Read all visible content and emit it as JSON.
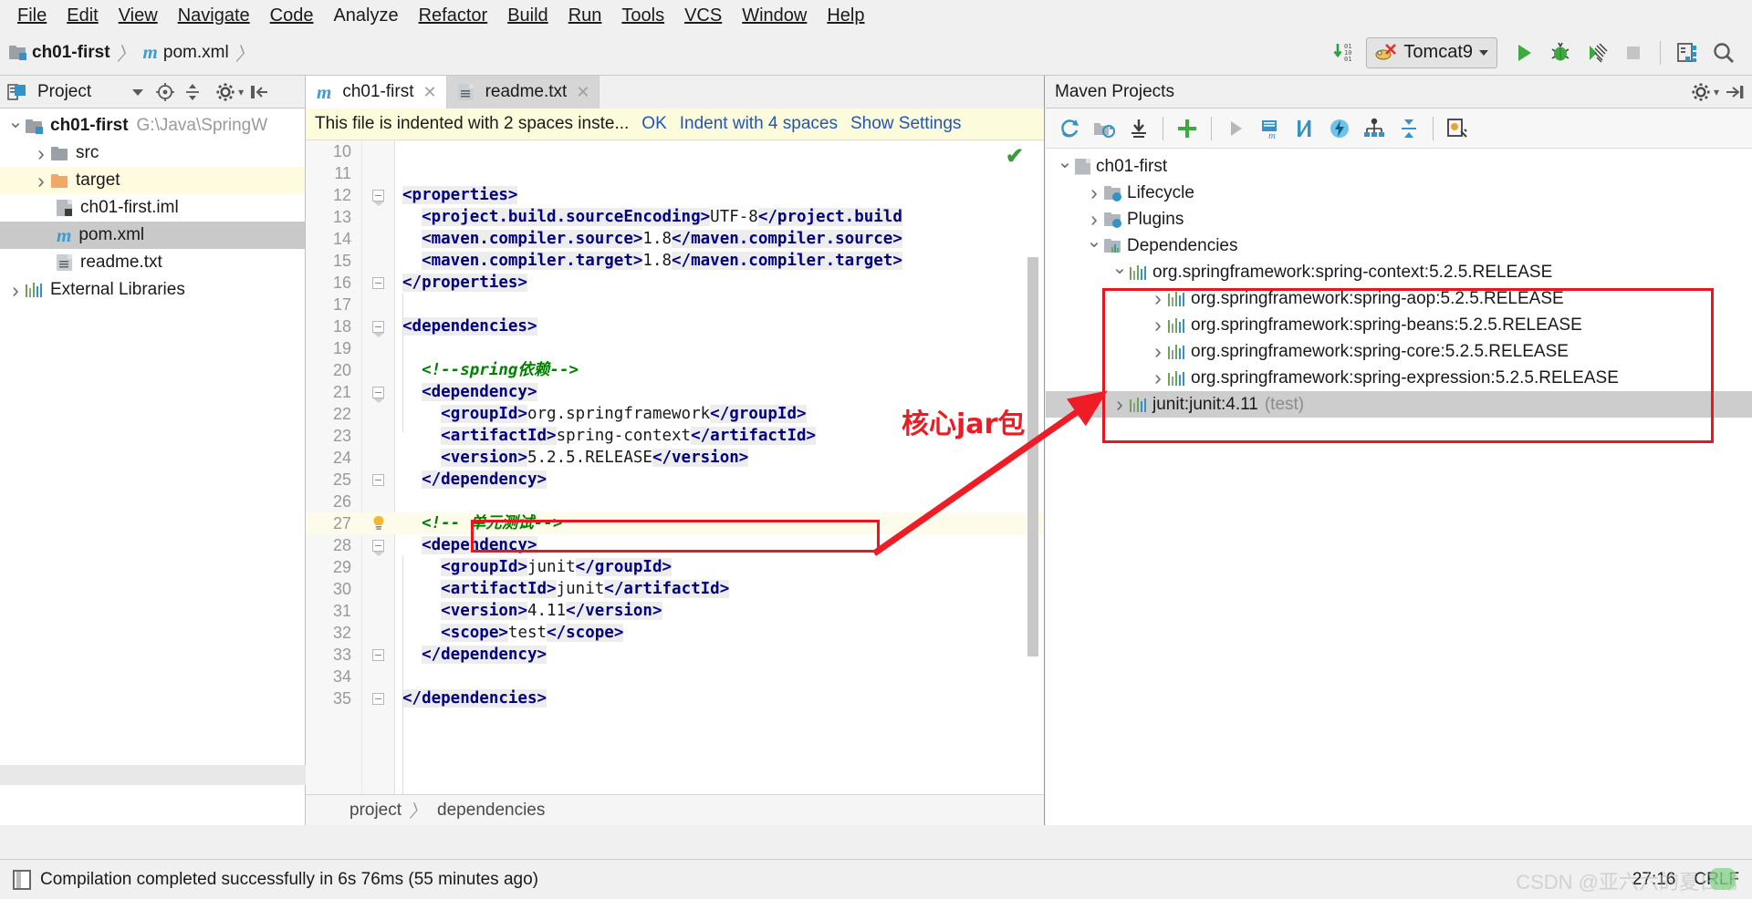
{
  "menubar": {
    "items": [
      {
        "label": "File"
      },
      {
        "label": "Edit"
      },
      {
        "label": "View"
      },
      {
        "label": "Navigate"
      },
      {
        "label": "Code"
      },
      {
        "label": "Analyze"
      },
      {
        "label": "Refactor"
      },
      {
        "label": "Build"
      },
      {
        "label": "Run"
      },
      {
        "label": "Tools"
      },
      {
        "label": "VCS"
      },
      {
        "label": "Window"
      },
      {
        "label": "Help"
      }
    ]
  },
  "navbar": {
    "breadcrumbs": [
      {
        "label": "ch01-first",
        "icon": "folder-icon"
      },
      {
        "label": "pom.xml",
        "icon": "maven-m-icon"
      }
    ],
    "run_config": {
      "label": "Tomcat9",
      "icon": "tomcat-icon"
    },
    "icons": [
      "download-updates-icon",
      "run-icon",
      "debug-icon",
      "run-coverage-icon",
      "stop-icon",
      "project-structure-icon",
      "search-icon"
    ]
  },
  "project_panel": {
    "title": "Project",
    "header_icons": [
      "chevron-down-icon",
      "locate-icon",
      "collapse-all-icon",
      "gear-icon",
      "hide-icon"
    ],
    "tree": [
      {
        "label": "ch01-first",
        "path": "G:\\Java\\SpringW",
        "icon": "folder-module-icon",
        "arrow": "down",
        "indent": 0,
        "bold": true,
        "state": "normal"
      },
      {
        "label": "src",
        "icon": "folder-icon",
        "arrow": "right",
        "indent": 1,
        "state": "normal"
      },
      {
        "label": "target",
        "icon": "folder-orange-icon",
        "arrow": "right",
        "indent": 1,
        "state": "highlight-yellow"
      },
      {
        "label": "ch01-first.iml",
        "icon": "iml-file-icon",
        "arrow": "none",
        "indent": 2,
        "state": "normal"
      },
      {
        "label": "pom.xml",
        "icon": "maven-m-icon",
        "arrow": "none",
        "indent": 2,
        "state": "selected"
      },
      {
        "label": "readme.txt",
        "icon": "text-file-icon",
        "arrow": "none",
        "indent": 2,
        "state": "normal"
      },
      {
        "label": "External Libraries",
        "icon": "library-icon",
        "arrow": "right",
        "indent": 0,
        "state": "normal"
      }
    ]
  },
  "editor": {
    "tabs": [
      {
        "label": "ch01-first",
        "icon": "maven-m-icon",
        "active": true
      },
      {
        "label": "readme.txt",
        "icon": "text-file-icon",
        "active": false
      }
    ],
    "notification": {
      "message": "This file is indented with 2 spaces inste...",
      "actions": [
        "OK",
        "Indent with 4 spaces",
        "Show Settings"
      ]
    },
    "breadcrumb": [
      "project",
      "dependencies"
    ],
    "inspection_status": "ok-check-icon",
    "lines": [
      {
        "n": 10,
        "html": "",
        "fold": "none"
      },
      {
        "n": 11,
        "html": "",
        "fold": "none"
      },
      {
        "n": 12,
        "html": "<span class='tg'>&lt;properties&gt;</span>",
        "fold": "minus-tip"
      },
      {
        "n": 13,
        "html": "  <span class='tg'>&lt;project.build.sourceEncoding&gt;</span><span class='val'>UTF-8</span><span class='tg'>&lt;/project.build</span>",
        "fold": "none"
      },
      {
        "n": 14,
        "html": "  <span class='tg'>&lt;maven.compiler.source&gt;</span><span class='val'>1.8</span><span class='tg'>&lt;/maven.compiler.source&gt;</span>",
        "fold": "none"
      },
      {
        "n": 15,
        "html": "  <span class='tg'>&lt;maven.compiler.target&gt;</span><span class='val'>1.8</span><span class='tg'>&lt;/maven.compiler.target&gt;</span>",
        "fold": "none"
      },
      {
        "n": 16,
        "html": "<span class='tg'>&lt;/properties&gt;</span>",
        "fold": "minus"
      },
      {
        "n": 17,
        "html": "",
        "fold": "none"
      },
      {
        "n": 18,
        "html": "<span class='tg'>&lt;dependencies&gt;</span>",
        "fold": "minus-tip"
      },
      {
        "n": 19,
        "html": "",
        "fold": "none"
      },
      {
        "n": 20,
        "html": "  <span class='cmt'>&lt;!--spring依赖--&gt;</span>",
        "fold": "none"
      },
      {
        "n": 21,
        "html": "  <span class='tg'>&lt;dependency&gt;</span>",
        "fold": "minus-tip"
      },
      {
        "n": 22,
        "html": "    <span class='tg'>&lt;groupId&gt;</span><span class='val'>org.springframework</span><span class='tg'>&lt;/groupId&gt;</span>",
        "fold": "none"
      },
      {
        "n": 23,
        "html": "    <span class='tg'>&lt;artifactId&gt;</span><span class='val'>spring-context</span><span class='tg'>&lt;/artifactId&gt;</span>",
        "fold": "none"
      },
      {
        "n": 24,
        "html": "    <span class='tg'>&lt;version&gt;</span><span class='val'>5.2.5.RELEASE</span><span class='tg'>&lt;/version&gt;</span>",
        "fold": "none"
      },
      {
        "n": 25,
        "html": "  <span class='tg'>&lt;/dependency&gt;</span>",
        "fold": "minus"
      },
      {
        "n": 26,
        "html": "",
        "fold": "none"
      },
      {
        "n": 27,
        "html": "  <span class='cmt'>&lt;!-- 单元测试--&gt;</span>",
        "fold": "bulb",
        "current": true
      },
      {
        "n": 28,
        "html": "  <span class='tg'>&lt;dependency&gt;</span>",
        "fold": "minus-tip"
      },
      {
        "n": 29,
        "html": "    <span class='tg'>&lt;groupId&gt;</span><span class='val'>junit</span><span class='tg'>&lt;/groupId&gt;</span>",
        "fold": "none"
      },
      {
        "n": 30,
        "html": "    <span class='tg'>&lt;artifactId&gt;</span><span class='val'>junit</span><span class='tg'>&lt;/artifactId&gt;</span>",
        "fold": "none"
      },
      {
        "n": 31,
        "html": "    <span class='tg'>&lt;version&gt;</span><span class='val'>4.11</span><span class='tg'>&lt;/version&gt;</span>",
        "fold": "none"
      },
      {
        "n": 32,
        "html": "    <span class='tg'>&lt;scope&gt;</span><span class='val'>test</span><span class='tg'>&lt;/scope&gt;</span>",
        "fold": "none"
      },
      {
        "n": 33,
        "html": "  <span class='tg'>&lt;/dependency&gt;</span>",
        "fold": "minus"
      },
      {
        "n": 34,
        "html": "",
        "fold": "none"
      },
      {
        "n": 35,
        "html": "<span class='tg'>&lt;/dependencies&gt;</span>",
        "fold": "minus"
      }
    ]
  },
  "maven_panel": {
    "title": "Maven Projects",
    "header_icons": [
      "gear-icon",
      "hide-icon"
    ],
    "toolbar_icons": [
      "reimport-icon",
      "generate-sources-icon",
      "download-sources-icon",
      "add-icon",
      "run-icon",
      "run-maven-build-icon",
      "toggle-skip-tests-icon",
      "execute-goal-icon",
      "show-dependencies-icon",
      "collapse-all-icon",
      "maven-settings-icon"
    ],
    "tree": [
      {
        "label": "ch01-first",
        "icon": "maven-project-icon",
        "arrow": "down",
        "indent": 0
      },
      {
        "label": "Lifecycle",
        "icon": "lifecycle-folder-icon",
        "arrow": "right",
        "indent": 1
      },
      {
        "label": "Plugins",
        "icon": "plugins-folder-icon",
        "arrow": "right",
        "indent": 1
      },
      {
        "label": "Dependencies",
        "icon": "dependencies-folder-icon",
        "arrow": "down",
        "indent": 1
      },
      {
        "label": "org.springframework:spring-context:5.2.5.RELEASE",
        "icon": "library-icon",
        "arrow": "down",
        "indent": 2
      },
      {
        "label": "org.springframework:spring-aop:5.2.5.RELEASE",
        "icon": "library-icon",
        "arrow": "right",
        "indent": 3
      },
      {
        "label": "org.springframework:spring-beans:5.2.5.RELEASE",
        "icon": "library-icon",
        "arrow": "right",
        "indent": 3
      },
      {
        "label": "org.springframework:spring-core:5.2.5.RELEASE",
        "icon": "library-icon",
        "arrow": "right",
        "indent": 3
      },
      {
        "label": "org.springframework:spring-expression:5.2.5.RELEASE",
        "icon": "library-icon",
        "arrow": "right",
        "indent": 3
      },
      {
        "label": "junit:junit:4.11",
        "suffix": "(test)",
        "icon": "library-icon",
        "arrow": "right",
        "indent": 2,
        "selected": true
      }
    ]
  },
  "annotations": {
    "label": "核心jar包",
    "color": "#ef1b24"
  },
  "statusbar": {
    "message": "Compilation completed successfully in 6s 76ms (55 minutes ago)",
    "caret_position": "27:16",
    "line_separator": "CRLF",
    "watermark": "CSDN @亚六六的夏日常"
  }
}
